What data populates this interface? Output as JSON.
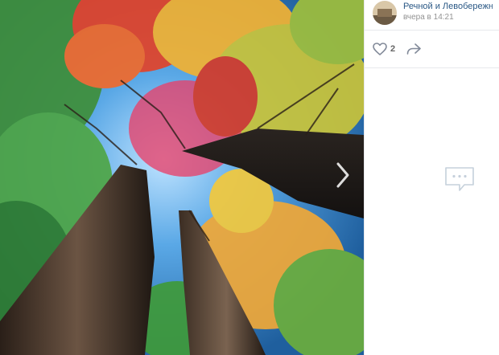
{
  "post": {
    "author_name": "Речной и Левобережный",
    "time": "вчера в 14:21",
    "likes": "2"
  },
  "icons": {
    "like": "heart-outline-icon",
    "share": "share-arrow-icon",
    "next": "chevron-right-icon",
    "comments_empty": "comment-bubble-icon"
  },
  "colors": {
    "link": "#2a5885",
    "muted": "#939393",
    "divider": "#e7e8ec"
  }
}
